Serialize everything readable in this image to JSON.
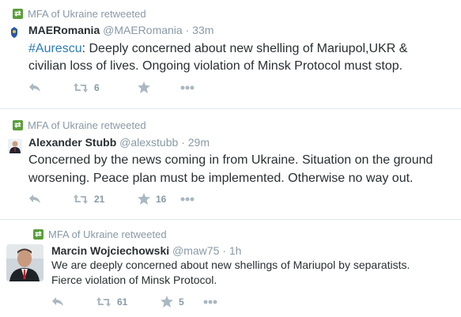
{
  "retweet_label": "MFA of Ukraine retweeted",
  "tweets": [
    {
      "name": "MAERomania",
      "handle": "@MAERomania",
      "time": "33m",
      "hashtag": "#Aurescu",
      "text": ": Deeply concerned about new shelling of Mariupol,UKR &\ncivilian loss of lives. Ongoing violation of Minsk Protocol must stop.",
      "retweets": "6",
      "favorites": ""
    },
    {
      "name": "Alexander Stubb",
      "handle": "@alexstubb",
      "time": "29m",
      "text": "Concerned by the news coming in from Ukraine. Situation on the ground\nworsening. Peace plan must be implemented. Otherwise no way out.",
      "retweets": "21",
      "favorites": "16"
    },
    {
      "name": "Marcin Wojciechowski",
      "handle": "@maw75",
      "time": "1h",
      "text": "We are deeply concerned about new shellings of Mariupol by separatists.\nFierce violation of Minsk Protocol.",
      "retweets": "61",
      "favorites": "5"
    }
  ],
  "colors": {
    "retweet_green": "#5a9e3a",
    "link_blue": "#2b7bb9",
    "meta_gray": "#8899a6"
  }
}
